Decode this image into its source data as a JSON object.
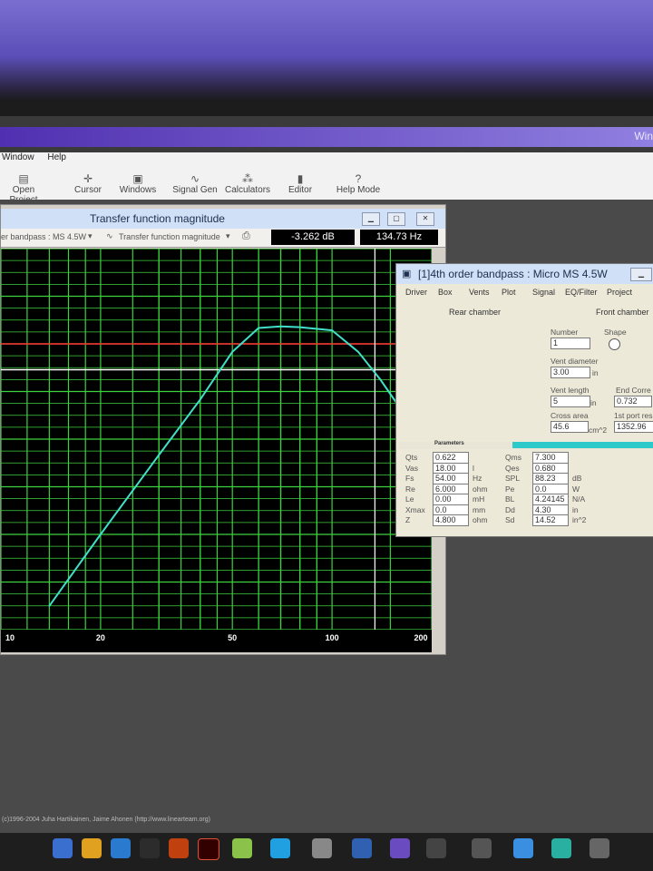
{
  "desktop": {
    "title_fragment": "Win"
  },
  "menu": [
    "Window",
    "Help"
  ],
  "toolbar": [
    {
      "label": "Open Project",
      "icon": "folder-icon"
    },
    {
      "label": "Cursor",
      "icon": "crosshair-icon"
    },
    {
      "label": "Windows",
      "icon": "windows-icon"
    },
    {
      "label": "Signal Gen",
      "icon": "wave-icon"
    },
    {
      "label": "Calculators",
      "icon": "calculator-icon"
    },
    {
      "label": "Editor",
      "icon": "editor-icon"
    },
    {
      "label": "Help Mode",
      "icon": "question-icon"
    }
  ],
  "tf_window": {
    "title": "Transfer function magnitude",
    "project_dropdown": "er bandpass : MS 4.5W",
    "plot_dropdown": "Transfer function magnitude",
    "readout_db": "-3.262 dB",
    "readout_hz": "134.73 Hz",
    "x_ticks": [
      "10",
      "20",
      "50",
      "100",
      "200"
    ]
  },
  "props_window": {
    "title": "[1]4th order bandpass : Micro MS 4.5W",
    "tabs": [
      "Driver",
      "Box",
      "Vents",
      "Plot",
      "Signal",
      "EQ/Filter",
      "Project"
    ],
    "rear_chamber": "Rear chamber",
    "front_chamber": "Front chamber",
    "number_label": "Number",
    "number_value": "1",
    "shape_label": "Shape",
    "vent_diameter_label": "Vent diameter",
    "vent_diameter_value": "3.00",
    "vent_diameter_unit": "in",
    "vent_length_label": "Vent length",
    "vent_length_value": "5",
    "vent_length_unit": "in",
    "end_correction_label": "End Corre",
    "end_correction_value": "0.732",
    "cross_area_label": "Cross area",
    "cross_area_value": "45.6",
    "cross_area_unit": "cm^2",
    "port_res_label": "1st port res",
    "port_res_value": "1352.96",
    "parameters_label": "Parameters",
    "params_left": [
      {
        "name": "Qts",
        "value": "0.622",
        "unit": ""
      },
      {
        "name": "Vas",
        "value": "18.00",
        "unit": "l"
      },
      {
        "name": "Fs",
        "value": "54.00",
        "unit": "Hz"
      },
      {
        "name": "Re",
        "value": "6.000",
        "unit": "ohm"
      },
      {
        "name": "Le",
        "value": "0.00",
        "unit": "mH"
      },
      {
        "name": "Xmax",
        "value": "0.0",
        "unit": "mm"
      },
      {
        "name": "Z",
        "value": "4.800",
        "unit": "ohm"
      }
    ],
    "params_right": [
      {
        "name": "Qms",
        "value": "7.300",
        "unit": ""
      },
      {
        "name": "Qes",
        "value": "0.680",
        "unit": ""
      },
      {
        "name": "SPL",
        "value": "88.23",
        "unit": "dB"
      },
      {
        "name": "Pe",
        "value": "0.0",
        "unit": "W"
      },
      {
        "name": "BL",
        "value": "4.24145",
        "unit": "N/A"
      },
      {
        "name": "Dd",
        "value": "4.30",
        "unit": "in"
      },
      {
        "name": "Sd",
        "value": "14.52",
        "unit": "in^2"
      }
    ]
  },
  "copyright": "(c)1996-2004 Juha Hartikainen, Jaime Ahonen (http://www.linearteam.org)",
  "colors": {
    "curve": "#40e0c8",
    "grid": "#3cd23c",
    "ref_line_red": "#ff3030",
    "ref_line_white": "#ffffff",
    "cursor": "#ffffff"
  },
  "chart_data": {
    "type": "line",
    "title": "Transfer function magnitude",
    "x_scale": "log",
    "xlim": [
      10,
      200
    ],
    "x_ticks": [
      10,
      20,
      50,
      100,
      200
    ],
    "x_unit": "Hz",
    "series": [
      {
        "x": [
          14,
          20,
          30,
          40,
          50,
          60,
          70,
          80,
          100,
          120,
          140,
          160
        ],
        "y": [
          -33,
          -24,
          -14,
          -7,
          -1,
          2,
          2.2,
          2.1,
          1.7,
          -1,
          -4.5,
          -8
        ]
      }
    ],
    "ylim": [
      -36,
      12
    ],
    "reference_lines_y": [
      0,
      -3.262
    ],
    "cursor_x": 134.73,
    "grid": true
  }
}
